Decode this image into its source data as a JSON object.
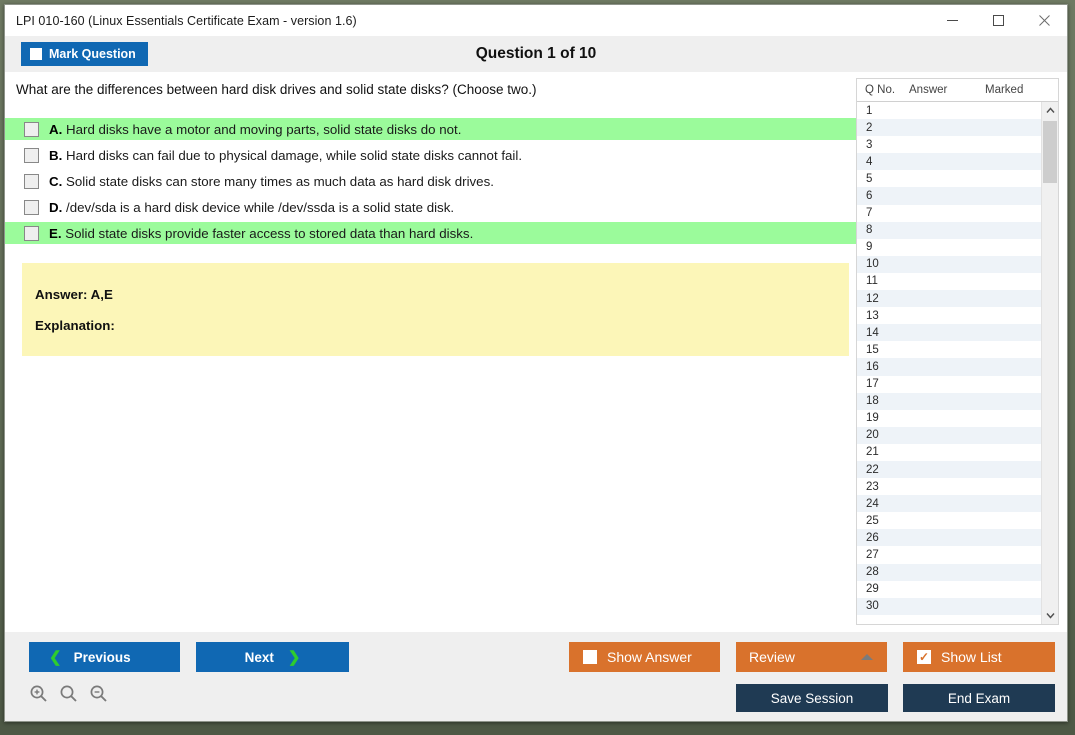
{
  "window": {
    "title": "LPI 010-160 (Linux Essentials Certificate Exam - version 1.6)",
    "controls": {
      "minimize": "minimize-button",
      "maximize": "maximize-button",
      "close": "close-button"
    }
  },
  "header": {
    "mark_question_label": "Mark Question",
    "mark_question_checked": false,
    "question_counter": "Question 1 of 10"
  },
  "question": {
    "stem": "What are the differences between hard disk drives and solid state disks? (Choose two.)",
    "options": [
      {
        "letter": "A.",
        "text": "Hard disks have a motor and moving parts, solid state disks do not.",
        "checked": false,
        "correct": true
      },
      {
        "letter": "B.",
        "text": "Hard disks can fail due to physical damage, while solid state disks cannot fail.",
        "checked": false,
        "correct": false
      },
      {
        "letter": "C.",
        "text": "Solid state disks can store many times as much data as hard disk drives.",
        "checked": false,
        "correct": false
      },
      {
        "letter": "D.",
        "text": "/dev/sda is a hard disk device while /dev/ssda is a solid state disk.",
        "checked": false,
        "correct": false
      },
      {
        "letter": "E.",
        "text": "Solid state disks provide faster access to stored data than hard disks.",
        "checked": false,
        "correct": true
      }
    ]
  },
  "answer_panel": {
    "answer_label": "Answer: A,E",
    "explanation_label": "Explanation:"
  },
  "question_list": {
    "columns": [
      "Q No.",
      "Answer",
      "Marked"
    ],
    "rows": [
      {
        "no": "1",
        "answer": "",
        "marked": ""
      },
      {
        "no": "2",
        "answer": "",
        "marked": ""
      },
      {
        "no": "3",
        "answer": "",
        "marked": ""
      },
      {
        "no": "4",
        "answer": "",
        "marked": ""
      },
      {
        "no": "5",
        "answer": "",
        "marked": ""
      },
      {
        "no": "6",
        "answer": "",
        "marked": ""
      },
      {
        "no": "7",
        "answer": "",
        "marked": ""
      },
      {
        "no": "8",
        "answer": "",
        "marked": ""
      },
      {
        "no": "9",
        "answer": "",
        "marked": ""
      },
      {
        "no": "10",
        "answer": "",
        "marked": ""
      },
      {
        "no": "11",
        "answer": "",
        "marked": ""
      },
      {
        "no": "12",
        "answer": "",
        "marked": ""
      },
      {
        "no": "13",
        "answer": "",
        "marked": ""
      },
      {
        "no": "14",
        "answer": "",
        "marked": ""
      },
      {
        "no": "15",
        "answer": "",
        "marked": ""
      },
      {
        "no": "16",
        "answer": "",
        "marked": ""
      },
      {
        "no": "17",
        "answer": "",
        "marked": ""
      },
      {
        "no": "18",
        "answer": "",
        "marked": ""
      },
      {
        "no": "19",
        "answer": "",
        "marked": ""
      },
      {
        "no": "20",
        "answer": "",
        "marked": ""
      },
      {
        "no": "21",
        "answer": "",
        "marked": ""
      },
      {
        "no": "22",
        "answer": "",
        "marked": ""
      },
      {
        "no": "23",
        "answer": "",
        "marked": ""
      },
      {
        "no": "24",
        "answer": "",
        "marked": ""
      },
      {
        "no": "25",
        "answer": "",
        "marked": ""
      },
      {
        "no": "26",
        "answer": "",
        "marked": ""
      },
      {
        "no": "27",
        "answer": "",
        "marked": ""
      },
      {
        "no": "28",
        "answer": "",
        "marked": ""
      },
      {
        "no": "29",
        "answer": "",
        "marked": ""
      },
      {
        "no": "30",
        "answer": "",
        "marked": ""
      }
    ]
  },
  "footer": {
    "previous_label": "Previous",
    "next_label": "Next",
    "show_answer_label": "Show Answer",
    "show_answer_checked": false,
    "review_label": "Review",
    "show_list_label": "Show List",
    "show_list_checked": true,
    "save_session_label": "Save Session",
    "end_exam_label": "End Exam",
    "zoom_icons": [
      "zoom-in-icon",
      "zoom-reset-icon",
      "zoom-out-icon"
    ]
  },
  "colors": {
    "accent_blue": "#1068b3",
    "accent_orange": "#d9722c",
    "navy": "#1f3a53",
    "correct_green": "#9bfb9b",
    "answer_yellow": "#fcf6b8",
    "chevron_green": "#2ecc2e"
  }
}
